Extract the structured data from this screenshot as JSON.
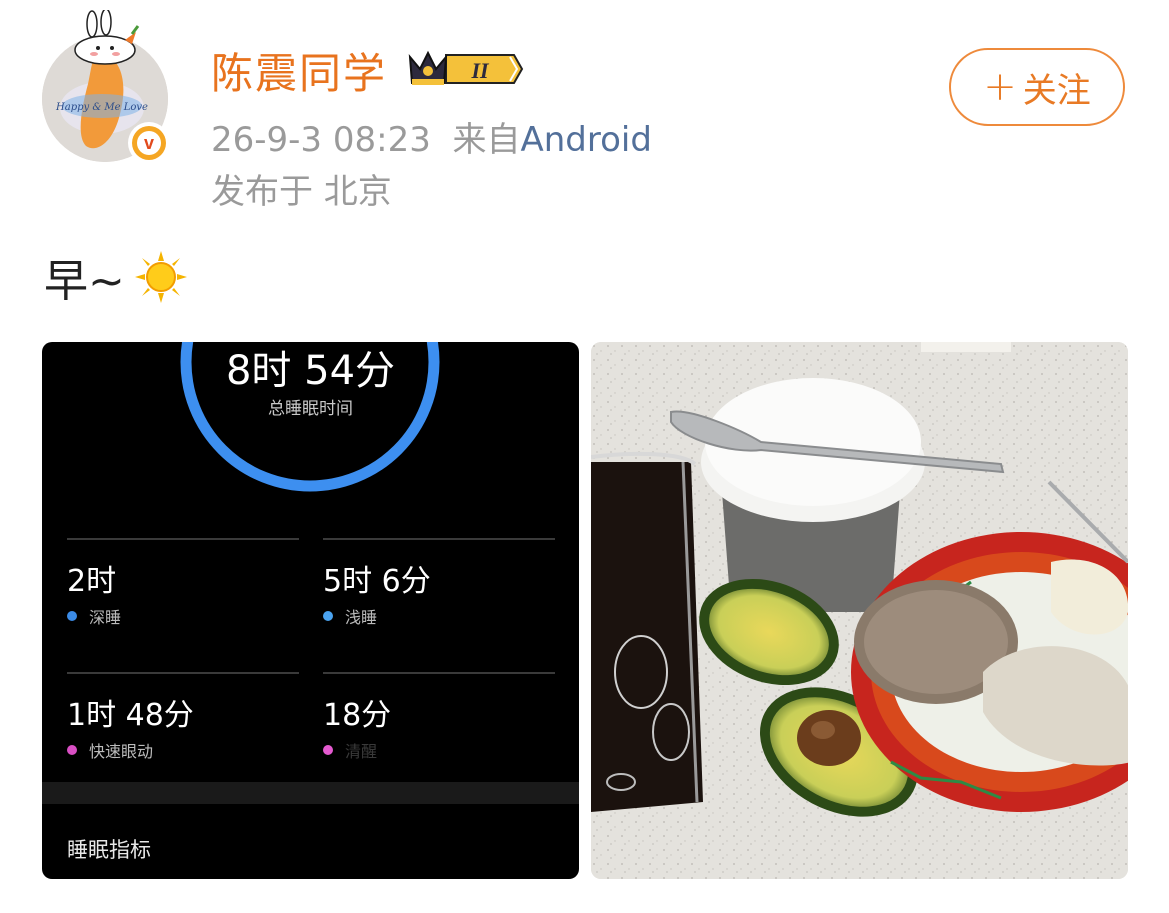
{
  "user": {
    "name": "陈震同学",
    "vip_level": "II",
    "time": "26-9-3 08:23",
    "from_prefix": "来自",
    "source": "Android",
    "location": "发布于 北京",
    "follow_label": "关注"
  },
  "post": {
    "text": "早~"
  },
  "sleep_image": {
    "total": "8时 54分",
    "total_label": "总睡眠时间",
    "stats": [
      {
        "value": "2时",
        "label": "深睡",
        "color": "#3b8be6"
      },
      {
        "value": "5时 6分",
        "label": "浅睡",
        "color": "#4aa3f0"
      },
      {
        "value": "1时 48分",
        "label": "快速眼动",
        "color": "#d94fc4"
      },
      {
        "value": "18分",
        "label": "清醒",
        "color": "#e45ad0"
      }
    ],
    "metrics_label": "睡眠指标"
  },
  "colors": {
    "accent_orange": "#e8731e",
    "source_blue": "#53709a",
    "meta_gray": "#9a9a9a",
    "ring_blue": "#3d8ff0"
  }
}
